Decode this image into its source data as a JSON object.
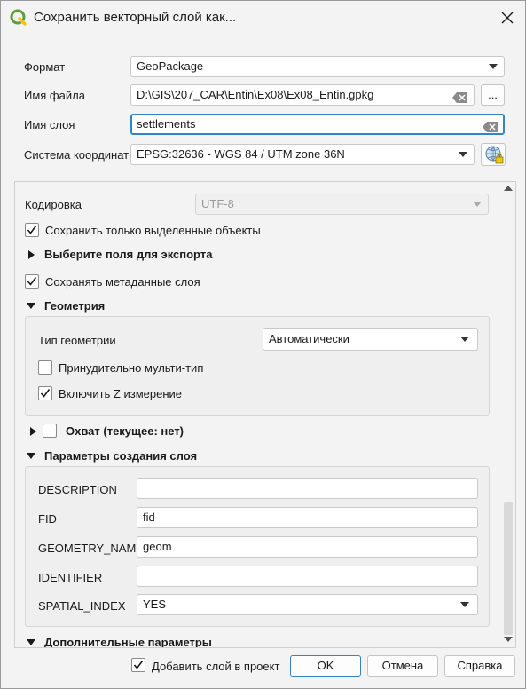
{
  "window": {
    "title": "Сохранить векторный слой как..."
  },
  "form": {
    "format_label": "Формат",
    "format_value": "GeoPackage",
    "filename_label": "Имя файла",
    "filename_value": "D:\\GIS\\207_CAR\\Entin\\Ex08\\Ex08_Entin.gpkg",
    "browse_label": "...",
    "layername_label": "Имя слоя",
    "layername_value": "settlements",
    "crs_label": "Система координат",
    "crs_value": "EPSG:32636 - WGS 84 / UTM zone 36N"
  },
  "options": {
    "encoding_label": "Кодировка",
    "encoding_value": "UTF-8",
    "save_selected_label": "Сохранить только выделенные объекты",
    "save_selected_checked": true,
    "fields_section": "Выберите поля для экспорта",
    "save_metadata_label": "Сохранять метаданные слоя",
    "save_metadata_checked": true,
    "geometry_section": "Геометрия",
    "geometry_type_label": "Тип геометрии",
    "geometry_type_value": "Автоматически",
    "force_multi_label": "Принудительно мульти-тип",
    "force_multi_checked": false,
    "include_z_label": "Включить Z измерение",
    "include_z_checked": true,
    "extent_section": "Охват (текущее: нет)",
    "layer_options_section": "Параметры создания слоя",
    "layer_options": [
      {
        "name": "DESCRIPTION",
        "value": ""
      },
      {
        "name": "FID",
        "value": "fid"
      },
      {
        "name": "GEOMETRY_NAME",
        "value": "geom"
      },
      {
        "name": "IDENTIFIER",
        "value": ""
      },
      {
        "name": "SPATIAL_INDEX",
        "value": "YES"
      }
    ],
    "extra_section": "Дополнительные параметры"
  },
  "footer": {
    "add_to_project_label": "Добавить слой в проект",
    "add_to_project_checked": true,
    "ok": "OK",
    "cancel": "Отмена",
    "help": "Справка"
  },
  "colors": {
    "accent": "#2f84c8",
    "qgis_green": "#5b9e3a",
    "qgis_yellow": "#f0c419"
  }
}
